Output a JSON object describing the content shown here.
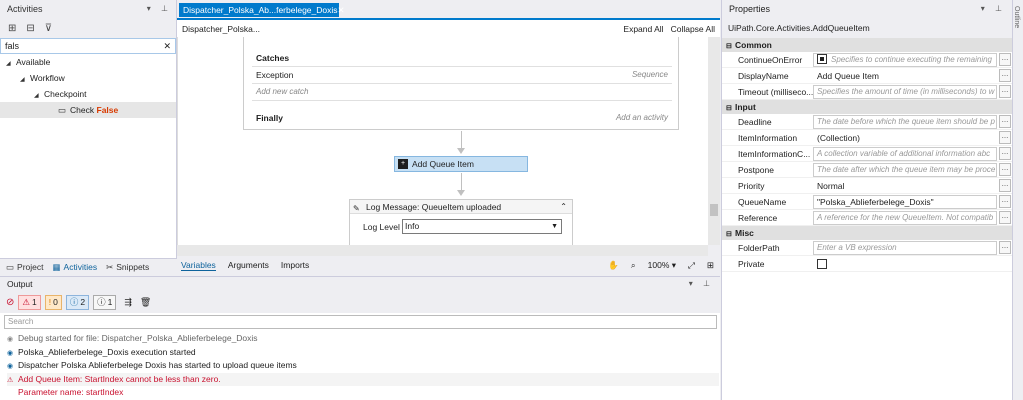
{
  "activities": {
    "title": "Activities",
    "search_value": "fals",
    "tree": [
      {
        "label": "Available",
        "indent": 0
      },
      {
        "label": "Workflow",
        "indent": 1
      },
      {
        "label": "Checkpoint",
        "indent": 2
      }
    ],
    "leaf_prefix": "Check ",
    "leaf_match": "False",
    "tabs": [
      "Project",
      "Activities",
      "Snippets"
    ]
  },
  "designer": {
    "tab_label": "Dispatcher_Polska_Ab...ferbelege_Doxis",
    "breadcrumb": "Dispatcher_Polska...",
    "expand_all": "Expand All",
    "collapse_all": "Collapse All",
    "catches_label": "Catches",
    "exception_label": "Exception",
    "exception_type": "Sequence",
    "add_new_catch": "Add new catch",
    "finally_label": "Finally",
    "add_activity": "Add an activity",
    "add_queue_label": "Add Queue Item",
    "log_message_title": "Log Message: QueueItem uploaded",
    "log_level_label": "Log Level",
    "log_level_value": "Info",
    "bottom_tabs": [
      "Variables",
      "Arguments",
      "Imports"
    ],
    "zoom": "100%"
  },
  "output": {
    "title": "Output",
    "counts": {
      "errors": "1",
      "warnings": "0",
      "info": "2",
      "trace": "1"
    },
    "search_placeholder": "Search",
    "lines": [
      {
        "text": "Debug started for file: Dispatcher_Polska_Ablieferbelege_Doxis",
        "kind": "debug"
      },
      {
        "text": "Polska_Ablieferbelege_Doxis execution started",
        "kind": "info"
      },
      {
        "text": "Dispatcher Polska Ablieferbelege Doxis has started to upload queue items",
        "kind": "info"
      },
      {
        "text": "Add Queue Item: StartIndex cannot be less than zero.",
        "kind": "error"
      },
      {
        "text": "Parameter name: startIndex",
        "kind": "error"
      }
    ]
  },
  "properties": {
    "title": "Properties",
    "type_name": "UiPath.Core.Activities.AddQueueItem",
    "categories": [
      {
        "name": "Common",
        "items": [
          {
            "key": "ContinueOnError",
            "value": "Specifies to continue executing the remaining",
            "style": "ph",
            "check": "on"
          },
          {
            "key": "DisplayName",
            "value": "Add Queue Item",
            "style": "plain"
          },
          {
            "key": "Timeout (milliseco...",
            "value": "Specifies the amount of time (in milliseconds) to w",
            "style": "ph"
          }
        ]
      },
      {
        "name": "Input",
        "items": [
          {
            "key": "Deadline",
            "value": "The date before which the queue item should be p",
            "style": "ph"
          },
          {
            "key": "ItemInformation",
            "value": "(Collection)",
            "style": "plain"
          },
          {
            "key": "ItemInformationC...",
            "value": "A collection variable of additional information abc",
            "style": "ph"
          },
          {
            "key": "Postpone",
            "value": "The date after which the queue item may be proce",
            "style": "ph"
          },
          {
            "key": "Priority",
            "value": "Normal",
            "style": "plain"
          },
          {
            "key": "QueueName",
            "value": "\"Polska_Ablieferbelege_Doxis\"",
            "style": "box"
          },
          {
            "key": "Reference",
            "value": "A reference for the new QueueItem. Not compatib",
            "style": "ph"
          }
        ]
      },
      {
        "name": "Misc",
        "items": [
          {
            "key": "FolderPath",
            "value": "Enter a VB expression",
            "style": "ph"
          },
          {
            "key": "Private",
            "value": "",
            "style": "check"
          }
        ]
      }
    ]
  },
  "outline": {
    "label": "Outline"
  }
}
